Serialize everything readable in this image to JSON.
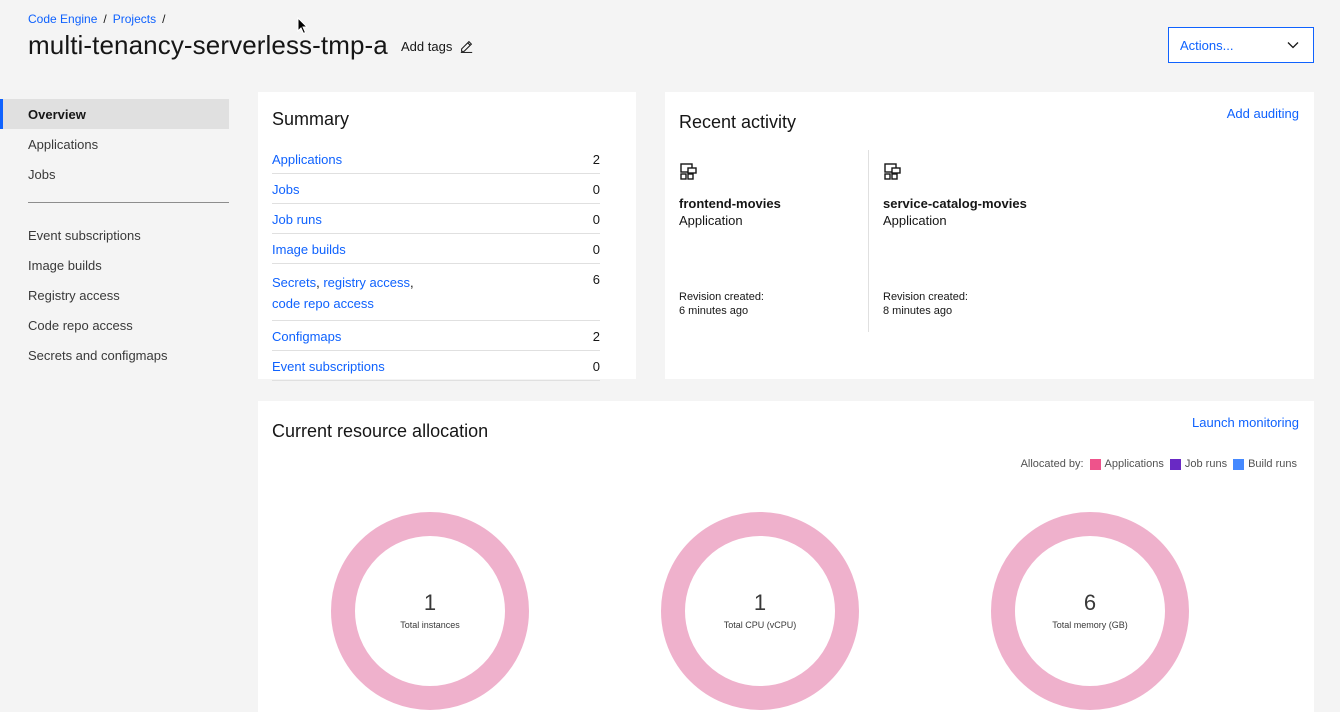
{
  "breadcrumb": {
    "item1": "Code Engine",
    "item2": "Projects",
    "sep": "/"
  },
  "page": {
    "title": "multi-tenancy-serverless-tmp-a",
    "add_tags": "Add tags"
  },
  "actions": {
    "label": "Actions..."
  },
  "sidenav": {
    "group1": [
      "Overview",
      "Applications",
      "Jobs"
    ],
    "group2": [
      "Event subscriptions",
      "Image builds",
      "Registry access",
      "Code repo access",
      "Secrets and configmaps"
    ]
  },
  "summary": {
    "title": "Summary",
    "rows": [
      {
        "label": "Applications",
        "value": "2"
      },
      {
        "label": "Jobs",
        "value": "0"
      },
      {
        "label": "Job runs",
        "value": "0"
      },
      {
        "label": "Image builds",
        "value": "0"
      },
      {
        "label_parts": [
          "Secrets",
          "registry access",
          "code repo access"
        ],
        "value": "6"
      },
      {
        "label": "Configmaps",
        "value": "2"
      },
      {
        "label": "Event subscriptions",
        "value": "0"
      }
    ]
  },
  "recent": {
    "title": "Recent activity",
    "add_auditing": "Add auditing",
    "items": [
      {
        "name": "frontend-movies",
        "type": "Application",
        "rev_label": "Revision created:",
        "rev_time": "6 minutes ago",
        "icon": "application-icon"
      },
      {
        "name": "service-catalog-movies",
        "type": "Application",
        "rev_label": "Revision created:",
        "rev_time": "8 minutes ago",
        "icon": "application-icon"
      }
    ]
  },
  "allocation": {
    "title": "Current resource allocation",
    "launch": "Launch monitoring",
    "legend_label": "Allocated by:",
    "legend": [
      {
        "name": "Applications",
        "color": "#ee538b"
      },
      {
        "name": "Job runs",
        "color": "#6929c4"
      },
      {
        "name": "Build runs",
        "color": "#4589ff"
      }
    ],
    "donuts": [
      {
        "value": "1",
        "label": "Total instances"
      },
      {
        "value": "1",
        "label": "Total CPU (vCPU)"
      },
      {
        "value": "6",
        "label": "Total memory (GB)"
      }
    ]
  }
}
